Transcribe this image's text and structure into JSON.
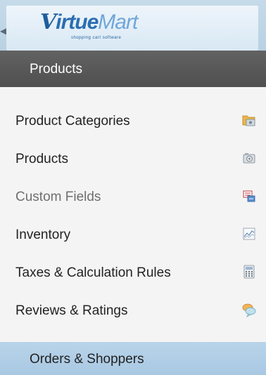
{
  "header": {
    "logo_main_v": "V",
    "logo_main_rest": "irtue",
    "logo_main_mart": "Mart",
    "logo_tagline": "shopping cart software"
  },
  "sections": {
    "products_title": "Products",
    "orders_title": "Orders & Shoppers"
  },
  "menu": {
    "items": [
      {
        "label": "Product Categories",
        "icon": "folder-icon"
      },
      {
        "label": "Products",
        "icon": "camera-icon"
      },
      {
        "label": "Custom Fields",
        "icon": "custom-fields-icon",
        "muted": true
      },
      {
        "label": "Inventory",
        "icon": "chart-icon"
      },
      {
        "label": "Taxes & Calculation Rules",
        "icon": "calculator-icon"
      },
      {
        "label": "Reviews & Ratings",
        "icon": "speech-bubble-icon"
      }
    ]
  },
  "colors": {
    "header_bg": "#c6dbe9",
    "products_bar": "#575757",
    "orders_bar": "#b0cee6",
    "menu_bg": "#f4f4f4"
  }
}
